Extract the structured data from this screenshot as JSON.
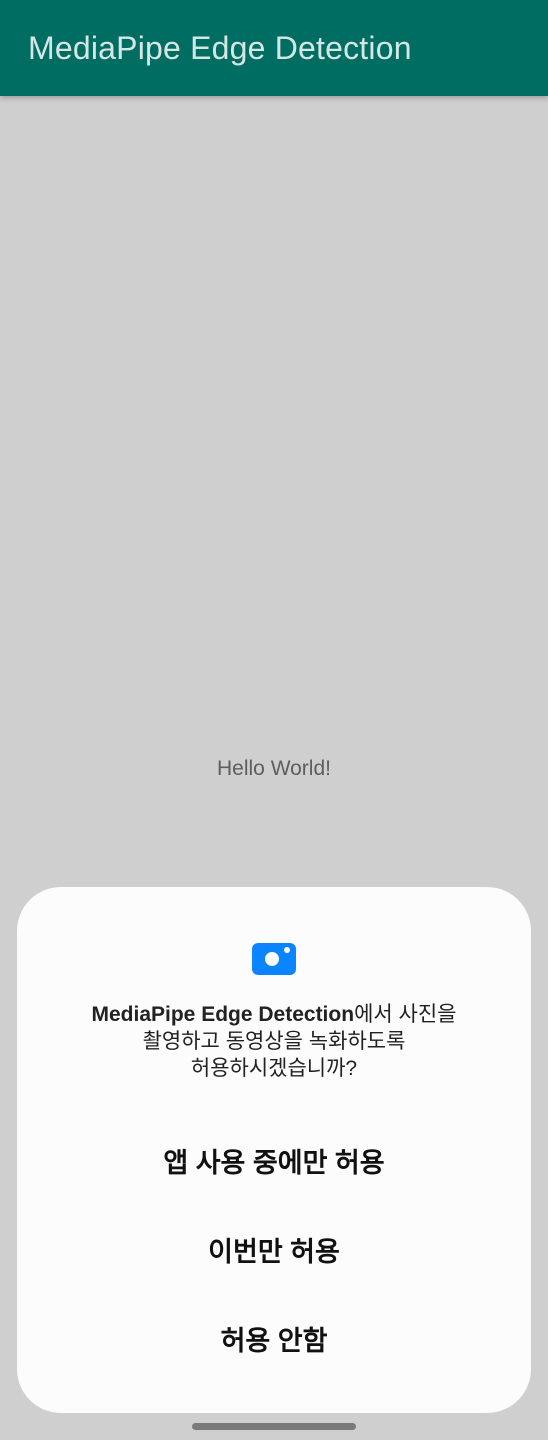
{
  "appbar": {
    "title": "MediaPipe Edge Detection",
    "color": "#006d63"
  },
  "main": {
    "text": "Hello World!"
  },
  "dialog": {
    "icon": "camera-icon",
    "icon_color": "#0a84ff",
    "app_name": "MediaPipe Edge Detection",
    "message_line1_suffix": "에서 사진을",
    "message_line2": "촬영하고 동영상을 녹화하도록",
    "message_line3": "허용하시겠습니까?",
    "options": [
      {
        "label": "앱 사용 중에만 허용"
      },
      {
        "label": "이번만 허용"
      },
      {
        "label": "허용 안함"
      }
    ]
  }
}
